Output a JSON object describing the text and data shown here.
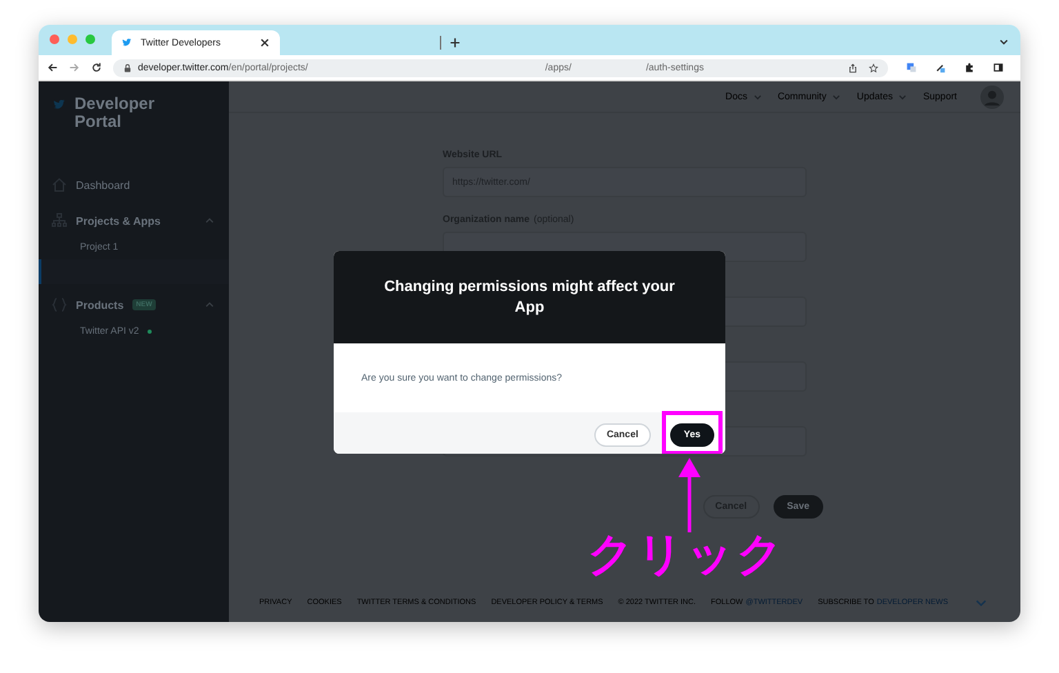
{
  "browser": {
    "tab_title": "Twitter Developers",
    "url_segments": [
      {
        "text": "developer.twitter.com",
        "kind": "host"
      },
      {
        "text": "/en/portal/projects/",
        "kind": "path"
      },
      {
        "text": "/apps/",
        "kind": "path"
      },
      {
        "text": "/auth-settings",
        "kind": "path"
      }
    ]
  },
  "sidebar": {
    "brand": "Developer Portal",
    "items": [
      {
        "label": "Dashboard"
      },
      {
        "label": "Projects & Apps",
        "expanded": true,
        "children": [
          {
            "label": "Project 1",
            "selected": false
          },
          {
            "selected": true
          }
        ]
      },
      {
        "label": "Products",
        "badge": "NEW",
        "expanded": true,
        "children": [
          {
            "label": "Twitter API v2",
            "selected": false,
            "color": "#1f8a5b"
          }
        ]
      }
    ]
  },
  "topnav": [
    {
      "label": "Docs",
      "dropdown": true
    },
    {
      "label": "Community",
      "dropdown": true
    },
    {
      "label": "Updates",
      "dropdown": true
    },
    {
      "label": "Support",
      "dropdown": false
    }
  ],
  "form": {
    "fields": [
      {
        "kind": "text",
        "label": "Website URL",
        "value": "https://twitter.com/"
      },
      {
        "kind": "text",
        "label": "Organization name",
        "hint": "(optional)"
      },
      {
        "kind": "text"
      },
      {
        "kind": "text"
      },
      {
        "kind": "text"
      }
    ],
    "actions": [
      {
        "label": "Cancel",
        "kind": "secondary"
      },
      {
        "label": "Save",
        "kind": "primary"
      }
    ]
  },
  "footer": [
    {
      "text": "PRIVACY"
    },
    {
      "text": "COOKIES"
    },
    {
      "text": "TWITTER TERMS & CONDITIONS"
    },
    {
      "text": "DEVELOPER POLICY & TERMS"
    },
    {
      "text": "© 2022 TWITTER INC."
    },
    {
      "text": "FOLLOW",
      "link": "@TWITTERDEV"
    },
    {
      "text": "SUBSCRIBE TO",
      "link": "DEVELOPER NEWS"
    }
  ],
  "dialog": {
    "title": "Changing permissions might affect your App",
    "message": "Are you sure you want to change permissions?",
    "buttons": [
      {
        "label": "Cancel",
        "kind": "secondary",
        "highlighted": false
      },
      {
        "label": "Yes",
        "kind": "primary",
        "highlighted": true
      }
    ]
  },
  "annotation": {
    "text": "クリック"
  }
}
